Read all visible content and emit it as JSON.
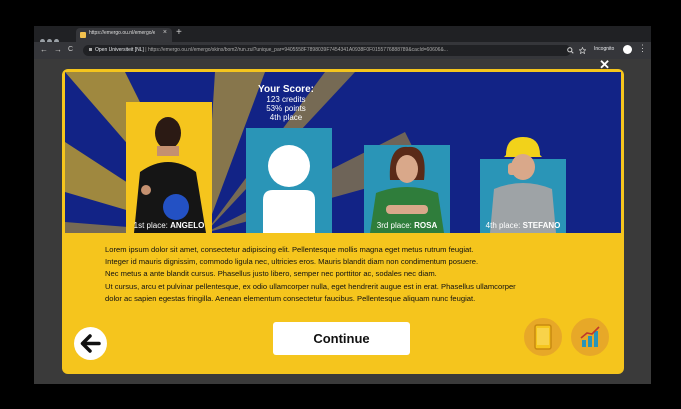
{
  "browser": {
    "tab_title": "https://emergo.ou.nl/emergo/ex",
    "tab_close": "×",
    "new_tab": "+",
    "nav_back": "←",
    "nav_forward": "→",
    "nav_reload": "C",
    "url_site": "Open Universiteit [NL]",
    "url_path": "https://emergo.ou.nl/emergo/skins/bom2/run.zul?unique_par=9405558F7898039F7454341A0938F0F0155776888789&cacId=60606&...",
    "search_icon": "search-icon",
    "bookmark_icon": "star-icon",
    "incognito_label": "Incognito",
    "menu_icon": "⋮"
  },
  "game": {
    "close_label": "✕",
    "score": {
      "heading": "Your Score:",
      "credits": "123 credits",
      "points": "53% points",
      "place": "4th place"
    },
    "podium": [
      {
        "prefix": "1st place: ",
        "name": "ANGELO",
        "color": "#f5c51d"
      },
      {
        "prefix": "",
        "name": "",
        "color": "#2a95b7"
      },
      {
        "prefix": "3rd place: ",
        "name": "ROSA",
        "color": "#2a95b7"
      },
      {
        "prefix": "4th place: ",
        "name": "STEFANO",
        "color": "#2a95b7"
      }
    ],
    "body_lines": [
      "Lorem ipsum dolor sit amet, consectetur adipiscing elit. Pellentesque mollis magna eget metus rutrum feugiat.",
      "Integer id mauris dignissim, commodo ligula nec, ultricies eros. Mauris blandit diam non condimentum posuere.",
      "Nec metus a ante blandit cursus. Phasellus justo libero, semper nec porttitor ac, sodales nec diam.",
      "Ut cursus, arcu et pulvinar pellentesque, ex odio ullamcorper nulla, eget hendrerit augue est in erat. Phasellus ullamcorper",
      "dolor ac sapien egestas fringilla. Aenean elementum consectetur faucibus. Pellentesque aliquam nunc feugiat."
    ],
    "continue_label": "Continue",
    "back_icon": "arrow-left-icon",
    "tablet_icon": "tablet-icon",
    "chart_icon": "chart-icon"
  },
  "colors": {
    "stage_blue": "#122386",
    "gold": "#f5c51d",
    "teal": "#2a95b7",
    "orange": "#e7a828"
  }
}
